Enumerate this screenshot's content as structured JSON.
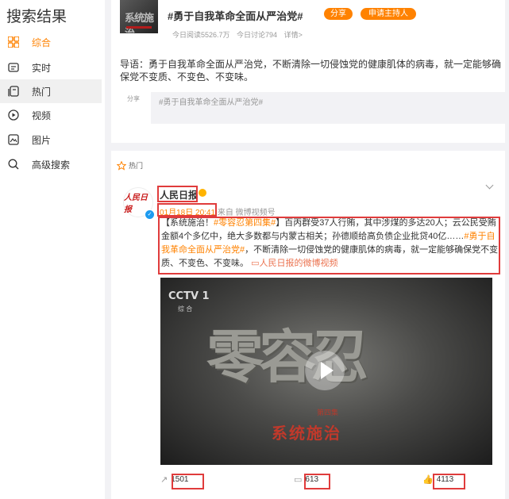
{
  "sidebar": {
    "title": "搜索结果",
    "items": [
      {
        "label": "综合",
        "icon": "grid-icon"
      },
      {
        "label": "实时",
        "icon": "realtime-icon"
      },
      {
        "label": "热门",
        "icon": "hot-icon"
      },
      {
        "label": "视频",
        "icon": "video-icon"
      },
      {
        "label": "图片",
        "icon": "picture-icon"
      },
      {
        "label": "高级搜索",
        "icon": "search-icon"
      }
    ]
  },
  "topic": {
    "thumb_text": "系统施治",
    "title": "#勇于自我革命全面从严治党#",
    "share_label": "分享",
    "host_label": "申请主持人",
    "reads": "今日阅读5526.7万",
    "discussions": "今日讨论794",
    "details": "详情>",
    "guide": "导语：勇于自我革命全面从严治党，不断清除一切侵蚀党的健康肌体的病毒，就一定能够确保党不变质、不变色、不变味。",
    "share_icon_text": "分享",
    "share_placeholder": "#勇于自我革命全面从严治党#"
  },
  "post": {
    "section_label": "热门",
    "avatar_text": "人民日报",
    "author": "人民日报",
    "time": "01月18日 20:41",
    "source": "来自 微博视频号",
    "text_p1": "【系统施治！",
    "hashtag1": "#零容忍第四集#",
    "text_p2": "】百丙群受37人行贿，其中涉煤的多达20人；云公民受贿金额4个多亿中，绝大多数都与内蒙古相关；孙德顺给高负债企业批贷40亿……",
    "hashtag2": "#勇于自我革命全面从严治党#",
    "text_p3": "，不断清除一切侵蚀党的健康肌体的病毒，就一定能够确保党不变质、不变色、不变味。",
    "video_link": "人民日报的微博视频",
    "video": {
      "channel": "CCTV 1",
      "channel_sub": "综 合",
      "title": "零容忍",
      "episode": "第四集",
      "subtitle": "系统施治"
    },
    "actions": {
      "reposts": "1501",
      "comments": "613",
      "likes": "4113"
    }
  },
  "colors": {
    "accent": "#ff8200",
    "highlight_box": "#e03c3c",
    "link": "#eb7350"
  }
}
